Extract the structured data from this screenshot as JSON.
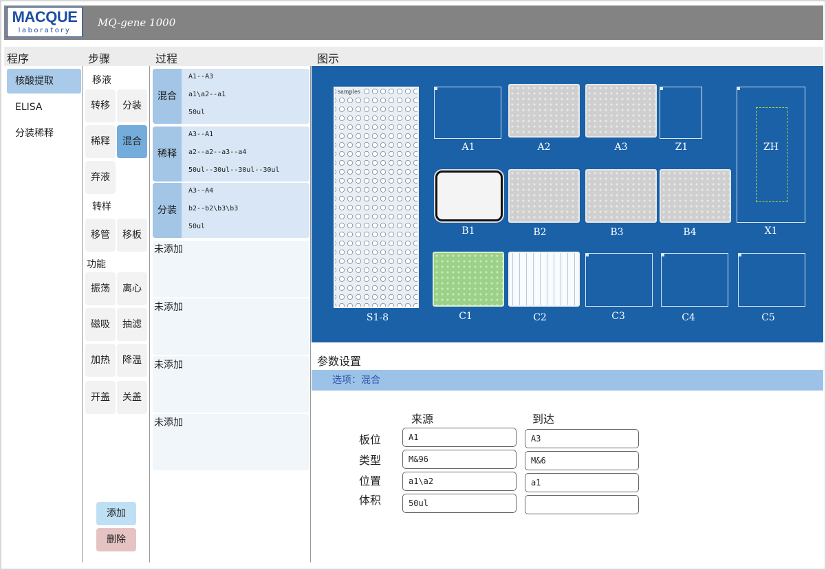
{
  "app": {
    "logo_brand": "MACQUE",
    "logo_sub": "laboratory",
    "title": "MQ-gene 1000"
  },
  "columns": {
    "programs": "程序",
    "steps": "步骤",
    "process": "过程",
    "diagram": "图示"
  },
  "programs": [
    "核酸提取",
    "ELISA",
    "分装稀释"
  ],
  "steps": {
    "group_pipette": "移液",
    "transfer": "转移",
    "dispense": "分装",
    "dilute": "稀释",
    "mix": "混合",
    "discard": "弃液",
    "group_transfer": "转样",
    "move_tube": "移管",
    "move_plate": "移板",
    "group_function": "功能",
    "shake": "振荡",
    "centrifuge": "离心",
    "magnetic": "磁吸",
    "filter": "抽滤",
    "heat": "加热",
    "cool": "降温",
    "open_lid": "开盖",
    "close_lid": "关盖",
    "add_button": "添加",
    "delete_button": "删除"
  },
  "process": [
    {
      "tag": "混合",
      "line1": "A1--A3",
      "line2": "a1\\a2--a1",
      "line3": "50ul"
    },
    {
      "tag": "稀释",
      "line1": "A3--A1",
      "line2": "a2--a2--a3--a4",
      "line3": "50ul--30ul--30ul--30ul"
    },
    {
      "tag": "分装",
      "line1": "A3--A4",
      "line2": "b2--b2\\b3\\b3",
      "line3": "50ul"
    }
  ],
  "process_empty": [
    "未添加",
    "未添加",
    "未添加",
    "未添加"
  ],
  "diagram": {
    "rack_title": "samples",
    "labels": {
      "S1_8": "S1-8",
      "A1": "A1",
      "A2": "A2",
      "A3": "A3",
      "Z1": "Z1",
      "ZH": "ZH",
      "B1": "B1",
      "B2": "B2",
      "B3": "B3",
      "B4": "B4",
      "X1": "X1",
      "C1": "C1",
      "C2": "C2",
      "C3": "C3",
      "C4": "C4",
      "C5": "C5"
    }
  },
  "params": {
    "title": "参数设置",
    "option": "选项：混合",
    "col_source": "来源",
    "col_target": "到达",
    "rows": [
      {
        "label": "板位",
        "source": "A1",
        "target": "A3"
      },
      {
        "label": "类型",
        "source": "M&96",
        "target": "M&6"
      },
      {
        "label": "位置",
        "source": "a1\\a2",
        "target": "a1"
      },
      {
        "label": "体积",
        "source": "50ul",
        "target": ""
      }
    ]
  }
}
